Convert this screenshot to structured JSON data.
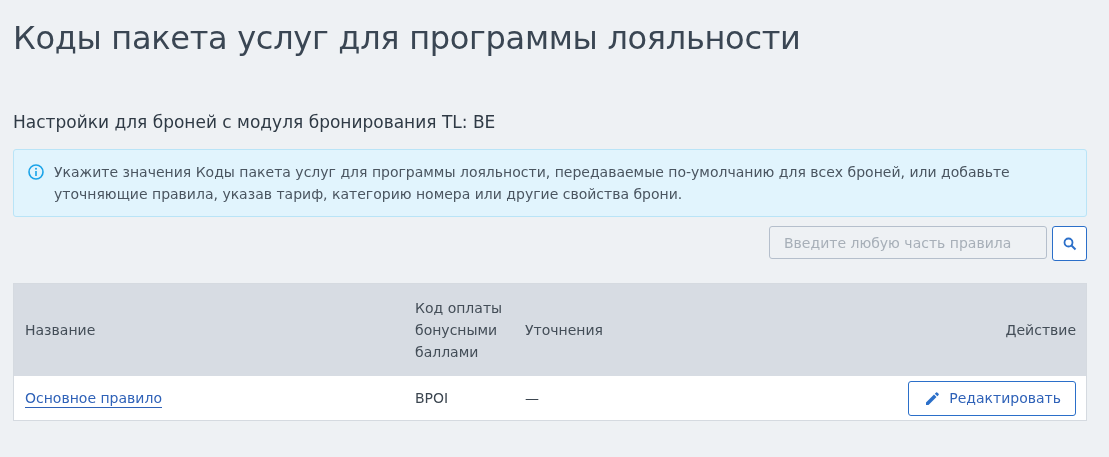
{
  "title": "Коды пакета услуг для программы лояльности",
  "subtitle": "Настройки для броней с модуля бронирования TL: BE",
  "info": "Укажите значения Коды пакета услуг для программы лояльности, передаваемые по-умолчанию для всех броней, или добавьте уточняющие правила, указав тариф, категорию номера или другие свойства брони.",
  "search": {
    "placeholder": "Введите любую часть правила"
  },
  "table": {
    "columns": [
      "Название",
      "Код оплаты бонусными баллами",
      "Уточнения",
      "Действие"
    ],
    "rows": [
      {
        "name": "Основное правило",
        "code": "BPOI",
        "refinements": "—",
        "action": "Редактировать"
      }
    ]
  }
}
